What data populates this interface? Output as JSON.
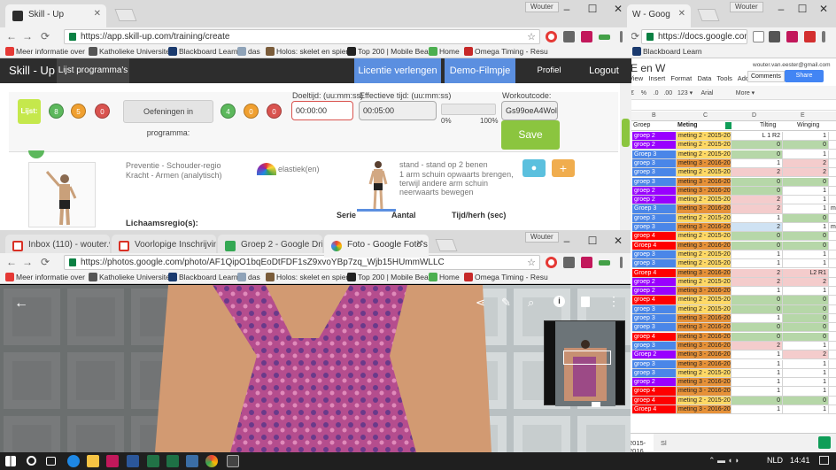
{
  "sheets_window": {
    "tab_title": "W - Goog",
    "user": "Wouter",
    "url": "https://docs.google.com",
    "bookmark": "Blackboard Learn",
    "doc_title": "E en W",
    "account_email": "wouter.van.eester@gmail.com",
    "menu": [
      "View",
      "Insert",
      "Format",
      "Data",
      "Tools",
      "Add-or"
    ],
    "comments_label": "Comments",
    "share_label": "Share",
    "toolbar_items": [
      "€",
      "%",
      ".0",
      ".00",
      "123 ▾",
      "Arial",
      "More ▾"
    ],
    "col_letters": [
      "B",
      "C",
      "D",
      "E"
    ],
    "headers": [
      "Groep",
      "Meting",
      "Tilting",
      "Winging"
    ],
    "sheet_tab": "2015-2016",
    "sheet_tab2": "Sl",
    "rows": [
      {
        "g": "groep 2",
        "gc": "#9900ff",
        "m": "meting 2 - 2015-2016",
        "mc": "#ffd966",
        "t": "L 1 R2",
        "tc": "#ffffff",
        "w": "1",
        "wc": "#ffffff",
        "x": ""
      },
      {
        "g": "groep 2",
        "gc": "#9900ff",
        "m": "meting 2 - 2015-2016",
        "mc": "#ffd966",
        "t": "0",
        "tc": "#b6d7a8",
        "w": "0",
        "wc": "#b6d7a8",
        "x": ""
      },
      {
        "g": "Groep 3",
        "gc": "#4a86e8",
        "m": "meting 2 - 2015-2016",
        "mc": "#ffd966",
        "t": "0",
        "tc": "#b6d7a8",
        "w": "1",
        "wc": "#ffffff",
        "x": ""
      },
      {
        "g": "groep 3",
        "gc": "#4a86e8",
        "m": "meting 3 - 2016-2017",
        "mc": "#e69138",
        "t": "1",
        "tc": "#ffffff",
        "w": "2",
        "wc": "#f4cccc",
        "x": ""
      },
      {
        "g": "groep 3",
        "gc": "#4a86e8",
        "m": "meting 2 - 2015-2016",
        "mc": "#ffd966",
        "t": "2",
        "tc": "#f4cccc",
        "w": "2",
        "wc": "#f4cccc",
        "x": ""
      },
      {
        "g": "groep 3",
        "gc": "#4a86e8",
        "m": "meting 3 - 2016-2017",
        "mc": "#e69138",
        "t": "0",
        "tc": "#b6d7a8",
        "w": "0",
        "wc": "#b6d7a8",
        "x": ""
      },
      {
        "g": "groep 2",
        "gc": "#9900ff",
        "m": "meting 3 - 2016-2017",
        "mc": "#e69138",
        "t": "0",
        "tc": "#b6d7a8",
        "w": "1",
        "wc": "#ffffff",
        "x": ""
      },
      {
        "g": "groep 2",
        "gc": "#9900ff",
        "m": "meting 2 - 2015-2016",
        "mc": "#ffd966",
        "t": "2",
        "tc": "#f4cccc",
        "w": "1",
        "wc": "#ffffff",
        "x": ""
      },
      {
        "g": "Groep 3",
        "gc": "#4a86e8",
        "m": "meting 3 - 2016-2017",
        "mc": "#e69138",
        "t": "2",
        "tc": "#f4cccc",
        "w": "1",
        "wc": "#ffffff",
        "x": "moe"
      },
      {
        "g": "groep 3",
        "gc": "#4a86e8",
        "m": "meting 2 - 2015-2016",
        "mc": "#ffd966",
        "t": "1",
        "tc": "#ffffff",
        "w": "0",
        "wc": "#b6d7a8",
        "x": ""
      },
      {
        "g": "groep 3",
        "gc": "#4a86e8",
        "m": "meting 3 - 2016-2017",
        "mc": "#e69138",
        "t": "2",
        "tc": "#cfe2f3",
        "w": "1",
        "wc": "#ffffff",
        "x": "moe"
      },
      {
        "g": "groep 4",
        "gc": "#ff0000",
        "m": "meting 2 - 2015-2016",
        "mc": "#ffd966",
        "t": "0",
        "tc": "#b6d7a8",
        "w": "0",
        "wc": "#b6d7a8",
        "x": ""
      },
      {
        "g": "Groep 4",
        "gc": "#ff0000",
        "m": "meting 3 - 2016-2017",
        "mc": "#e69138",
        "t": "0",
        "tc": "#b6d7a8",
        "w": "0",
        "wc": "#b6d7a8",
        "x": ""
      },
      {
        "g": "groep 3",
        "gc": "#4a86e8",
        "m": "meting 2 - 2015-2016",
        "mc": "#ffd966",
        "t": "1",
        "tc": "#ffffff",
        "w": "1",
        "wc": "#ffffff",
        "x": ""
      },
      {
        "g": "groep 3",
        "gc": "#4a86e8",
        "m": "meting 2 - 2015-2016",
        "mc": "#ffd966",
        "t": "1",
        "tc": "#ffffff",
        "w": "1",
        "wc": "#ffffff",
        "x": ""
      },
      {
        "g": "Groep 4",
        "gc": "#ff0000",
        "m": "meting 3 - 2016-2017",
        "mc": "#e69138",
        "t": "2",
        "tc": "#f4cccc",
        "w": "L2 R1",
        "wc": "#f4cccc",
        "x": ""
      },
      {
        "g": "groep 2",
        "gc": "#9900ff",
        "m": "meting 2 - 2015-2016",
        "mc": "#ffd966",
        "t": "2",
        "tc": "#f4cccc",
        "w": "2",
        "wc": "#f4cccc",
        "x": ""
      },
      {
        "g": "groep 2",
        "gc": "#9900ff",
        "m": "meting 3 - 2016-2017",
        "mc": "#e69138",
        "t": "1",
        "tc": "#ffffff",
        "w": "1",
        "wc": "#ffffff",
        "x": ""
      },
      {
        "g": "groep 4",
        "gc": "#ff0000",
        "m": "meting 2 - 2015-2016",
        "mc": "#ffd966",
        "t": "0",
        "tc": "#b6d7a8",
        "w": "0",
        "wc": "#b6d7a8",
        "x": ""
      },
      {
        "g": "groep 3",
        "gc": "#4a86e8",
        "m": "meting 2 - 2015-2016",
        "mc": "#ffd966",
        "t": "0",
        "tc": "#b6d7a8",
        "w": "0",
        "wc": "#b6d7a8",
        "x": ""
      },
      {
        "g": "groep 3",
        "gc": "#4a86e8",
        "m": "meting 3 - 2016-2017",
        "mc": "#e69138",
        "t": "1",
        "tc": "#ffffff",
        "w": "0",
        "wc": "#b6d7a8",
        "x": ""
      },
      {
        "g": "groep 3",
        "gc": "#4a86e8",
        "m": "meting 3 - 2016-2017",
        "mc": "#e69138",
        "t": "0",
        "tc": "#b6d7a8",
        "w": "0",
        "wc": "#b6d7a8",
        "x": ""
      },
      {
        "g": "groep 4",
        "gc": "#ff0000",
        "m": "meting 3 - 2016-2017",
        "mc": "#e69138",
        "t": "0",
        "tc": "#b6d7a8",
        "w": "0",
        "wc": "#b6d7a8",
        "x": ""
      },
      {
        "g": "groep 3",
        "gc": "#4a86e8",
        "m": "meting 3 - 2016-2017",
        "mc": "#e69138",
        "t": "2",
        "tc": "#f4cccc",
        "w": "1",
        "wc": "#ffffff",
        "x": ""
      },
      {
        "g": "Groep 2",
        "gc": "#9900ff",
        "m": "meting 3 - 2016-2017",
        "mc": "#e69138",
        "t": "1",
        "tc": "#ffffff",
        "w": "2",
        "wc": "#f4cccc",
        "x": ""
      },
      {
        "g": "groep 3",
        "gc": "#4a86e8",
        "m": "meting 3 - 2016-2017",
        "mc": "#e69138",
        "t": "1",
        "tc": "#ffffff",
        "w": "1",
        "wc": "#ffffff",
        "x": ""
      },
      {
        "g": "groep 3",
        "gc": "#4a86e8",
        "m": "meting 2 - 2015-2016",
        "mc": "#ffd966",
        "t": "1",
        "tc": "#ffffff",
        "w": "1",
        "wc": "#ffffff",
        "x": ""
      },
      {
        "g": "groep 2",
        "gc": "#9900ff",
        "m": "meting 3 - 2016-2017",
        "mc": "#e69138",
        "t": "1",
        "tc": "#ffffff",
        "w": "1",
        "wc": "#ffffff",
        "x": ""
      },
      {
        "g": "groep 4",
        "gc": "#ff0000",
        "m": "meting 3 - 2016-2017",
        "mc": "#e69138",
        "t": "1",
        "tc": "#ffffff",
        "w": "1",
        "wc": "#ffffff",
        "x": ""
      },
      {
        "g": "groep 4",
        "gc": "#ff0000",
        "m": "meting 2 - 2015-2016",
        "mc": "#ffd966",
        "t": "0",
        "tc": "#b6d7a8",
        "w": "0",
        "wc": "#b6d7a8",
        "x": ""
      },
      {
        "g": "Groep 4",
        "gc": "#ff0000",
        "m": "meting 3 - 2016-2017",
        "mc": "#e69138",
        "t": "1",
        "tc": "#ffffff",
        "w": "1",
        "wc": "#ffffff",
        "x": ""
      }
    ]
  },
  "skillup_window": {
    "tab_title": "Skill - Up",
    "user": "Wouter",
    "url": "https://app.skill-up.com/training/create",
    "bookmarks": [
      "Meer informatie over",
      "Katholieke Universiteit",
      "Blackboard Learn",
      "das",
      "Holos: skelet en spier",
      "Top 200 | Mobile Beat",
      "Home",
      "Omega Timing - Resu"
    ],
    "brand": "Skill - Up",
    "nav_programs": "Lijst programma's",
    "nav_license": "Licentie verlengen",
    "nav_demo": "Demo-Filmpje",
    "nav_profile": "Profiel gebruiker",
    "nav_logout": "Logout",
    "lists_label": "Lijst:",
    "list_counts": [
      "8",
      "5",
      "0"
    ],
    "exercises_label": "Oefeningen in programma:",
    "exercise_counts": [
      "4",
      "0",
      "0"
    ],
    "target_time_label": "Doeltijd: (uu:mm:ss)",
    "target_time_value": "00:00:00",
    "effective_time_label": "Effectieve tijd: (uu:mm:ss)",
    "effective_time_value": "00:05:00",
    "progress_min": "0%",
    "progress_max": "100%",
    "progress_fraction": 0,
    "workout_code_label": "Workoutcode:",
    "workout_code_value": "Gs99oeA4Wol",
    "save_label": "Save",
    "exercise_text": [
      "Preventie - Schouder-regio",
      "Kracht - Armen (analytisch)"
    ],
    "material": "elastiek(en)",
    "instructions": [
      "stand - stand op 2 benen",
      "1 arm schuin opwaarts brengen,",
      "terwijl andere arm schuin",
      "neerwaarts bewegen"
    ],
    "body_region_label": "Lichaamsregio(s):",
    "col_serie": "Serie",
    "col_aantal": "Aantal",
    "col_tijd": "Tijd/herh (sec)",
    "add_symbol": "+"
  },
  "photos_window": {
    "user": "Wouter",
    "tabs": [
      "Inbox (110) - wouter.van",
      "Voorlopige Inschrijvingen",
      "Groep 2 - Google Drive",
      "Foto - Google Foto's"
    ],
    "url": "https://photos.google.com/photo/AF1QipO1bqEoDtFDF1sZ9xvoYBp7zq_Wjb15HUmmWLLC",
    "bookmarks": [
      "Meer informatie over",
      "Katholieke Universiteit",
      "Blackboard Learn",
      "das",
      "Holos: skelet en spier",
      "Top 200 | Mobile Beat",
      "Home",
      "Omega Timing - Resu"
    ]
  },
  "taskbar": {
    "language": "NLD",
    "time": "14:41"
  },
  "colors": {
    "skillup_blue": "#5b8fe0",
    "skillup_green": "#8bc53f",
    "nav_dark": "#2d2d2d"
  }
}
